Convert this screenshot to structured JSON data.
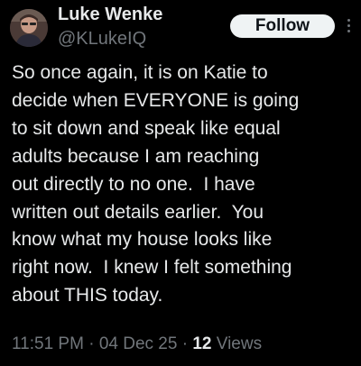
{
  "author": {
    "display_name": "Luke Wenke",
    "handle": "@KLukeIQ"
  },
  "follow_button": {
    "label": "Follow"
  },
  "more_menu": {
    "icon": "more-vertical-icon"
  },
  "tweet": {
    "lines": [
      "So once again, it is on Katie to",
      "decide when EVERYONE is going",
      "to sit down and speak like equal",
      "adults because I am reaching",
      "out directly to no one.  I have",
      "written out details earlier.  You",
      "know what my house looks like",
      "right now.  I knew I felt something",
      "about THIS today."
    ]
  },
  "meta": {
    "time": "11:51 PM",
    "separator": "·",
    "date": "04 Dec 25",
    "views_count": "12",
    "views_label": "Views"
  },
  "colors": {
    "background": "#000000",
    "primary_text": "#e7e9ea",
    "secondary_text": "#71767b",
    "follow_button_bg": "#eff3f4",
    "follow_button_text": "#0f1419"
  }
}
